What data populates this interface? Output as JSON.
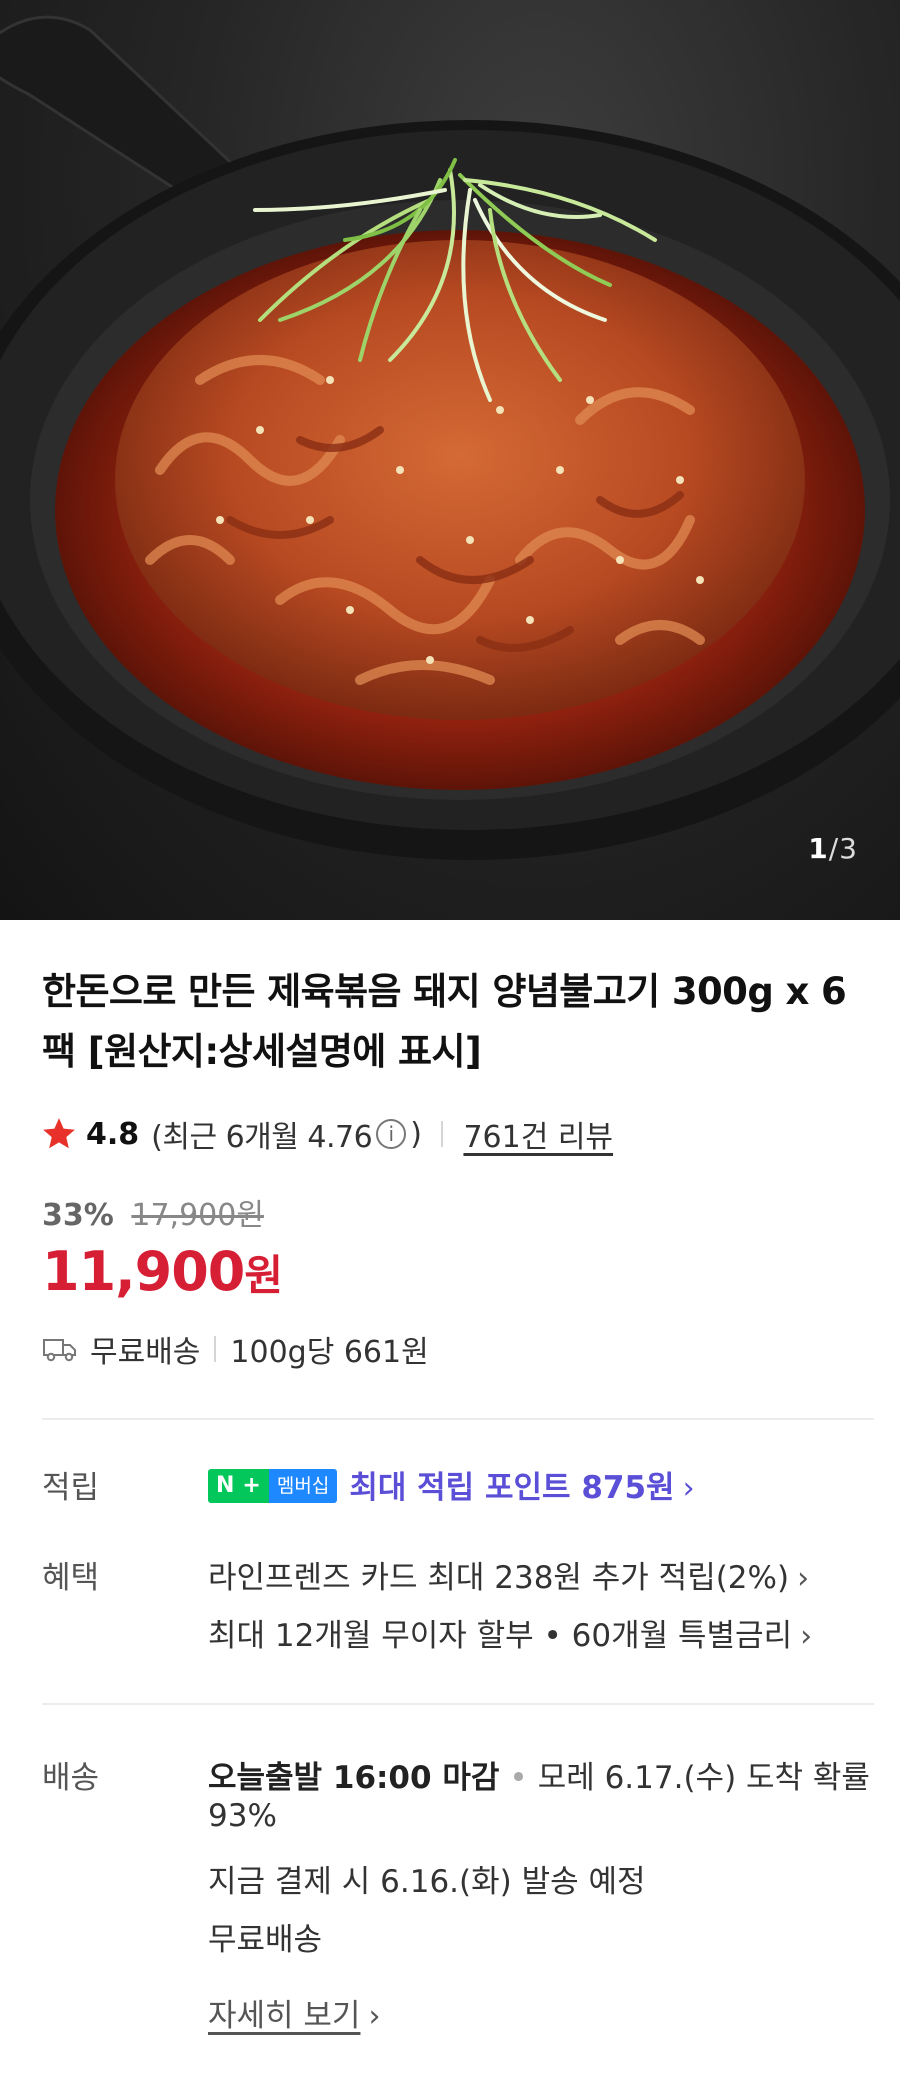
{
  "gallery": {
    "current": "1",
    "separator": "/",
    "total": "3"
  },
  "product": {
    "title": "한돈으로 만든 제육볶음 돼지 양념불고기 300g x 6팩 [원산지:상세설명에 표시]"
  },
  "rating": {
    "score": "4.8",
    "recent_prefix": "(최근 6개월 4.76",
    "recent_suffix": ")",
    "info_symbol": "i",
    "review_link": "761건 리뷰"
  },
  "price": {
    "discount": "33%",
    "original": "17,900원",
    "sale": "11,900",
    "currency": "원"
  },
  "shipping_summary": {
    "free": "무료배송",
    "unit_price": "100g당 661원"
  },
  "points": {
    "label": "적립",
    "badge_n": "N",
    "badge_plus": "+",
    "badge_membership": "멤버십",
    "text": "최대 적립 포인트 875원"
  },
  "benefits": {
    "label": "혜택",
    "line1": "라인프렌즈 카드 최대 238원 추가 적립(2%)",
    "line2": "최대 12개월 무이자 할부 • 60개월 특별금리"
  },
  "delivery": {
    "label": "배송",
    "today": "오늘출발 16:00 마감",
    "dot": "•",
    "arrival_a": "모레 6.17.(수) 도착 확률",
    "arrival_b": "93%",
    "ship_date": "지금 결제 시 6.16.(화) 발송 예정",
    "fee": "무료배송",
    "more_link": "자세히 보기"
  },
  "chevron": "›",
  "colors": {
    "price_red": "#d61f35",
    "points_purple": "#5a4fd6",
    "naver_green": "#03c75a",
    "membership_blue": "#1e88ff",
    "star": "#e8312a"
  }
}
